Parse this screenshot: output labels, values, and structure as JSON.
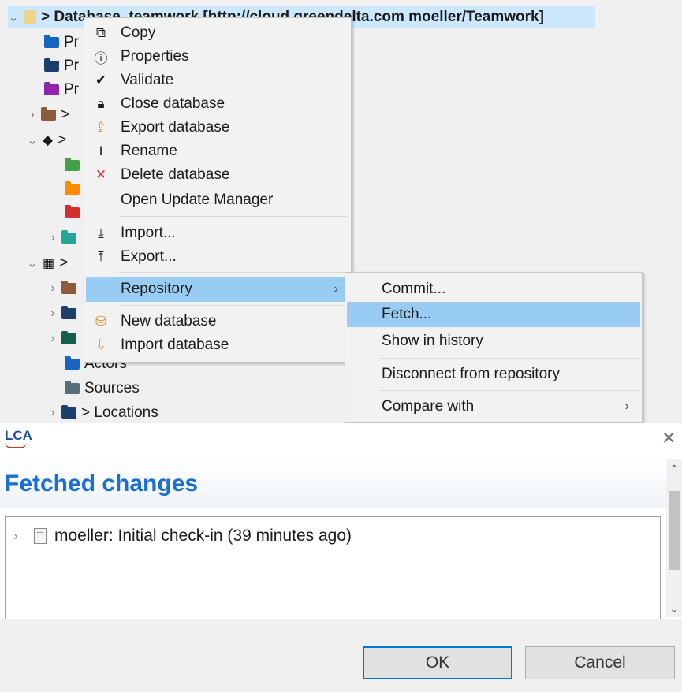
{
  "tree": {
    "root_label": "> Database_teamwork [http://cloud.greendelta.com moeller/Teamwork]",
    "project_items_prefix": "Pr",
    "collapsed_group_label": ">",
    "actors_label": "Actors",
    "sources_label": "Sources",
    "locations_label": "> Locations"
  },
  "context_menu": {
    "items": [
      {
        "label": "Copy",
        "icon": "copy-icon"
      },
      {
        "label": "Properties",
        "icon": "info-icon"
      },
      {
        "label": "Validate",
        "icon": "check-circle-icon"
      },
      {
        "label": "Close database",
        "icon": "lock-icon"
      },
      {
        "label": "Export database",
        "icon": "export-database-icon"
      },
      {
        "label": "Rename",
        "icon": "rename-icon"
      },
      {
        "label": "Delete database",
        "icon": "delete-icon"
      },
      {
        "label": "Open Update Manager",
        "icon": ""
      },
      {
        "label": "Import...",
        "icon": "import-icon"
      },
      {
        "label": "Export...",
        "icon": "export-icon"
      },
      {
        "label": "Repository",
        "icon": "",
        "submenu_arrow": "›"
      },
      {
        "label": "New database",
        "icon": "new-database-icon"
      },
      {
        "label": "Import database",
        "icon": "import-database-icon"
      }
    ]
  },
  "repository_submenu": {
    "items": [
      {
        "label": "Commit..."
      },
      {
        "label": "Fetch..."
      },
      {
        "label": "Show in history"
      },
      {
        "label": "Disconnect from repository"
      },
      {
        "label": "Compare with",
        "submenu_arrow": "›"
      }
    ]
  },
  "dialog": {
    "logo_text": "LCA",
    "title": "Fetched changes",
    "entries": [
      {
        "text": "moeller: Initial check-in (39 minutes ago)"
      }
    ],
    "ok_label": "OK",
    "cancel_label": "Cancel",
    "close_symbol": "×"
  },
  "colors": {
    "selection": "#cce8ff",
    "menu_highlight": "#99ccf3",
    "title_blue": "#1b6fce",
    "folder_blue": "#1565c0",
    "folder_dark": "#1a3f6b",
    "folder_purple": "#8e24aa",
    "folder_brown": "#8d5a3b",
    "folder_green": "#43a047",
    "folder_orange": "#fb8c00",
    "folder_red": "#d32f2f",
    "folder_teal": "#26a69a",
    "folder_slate": "#546e7a"
  }
}
